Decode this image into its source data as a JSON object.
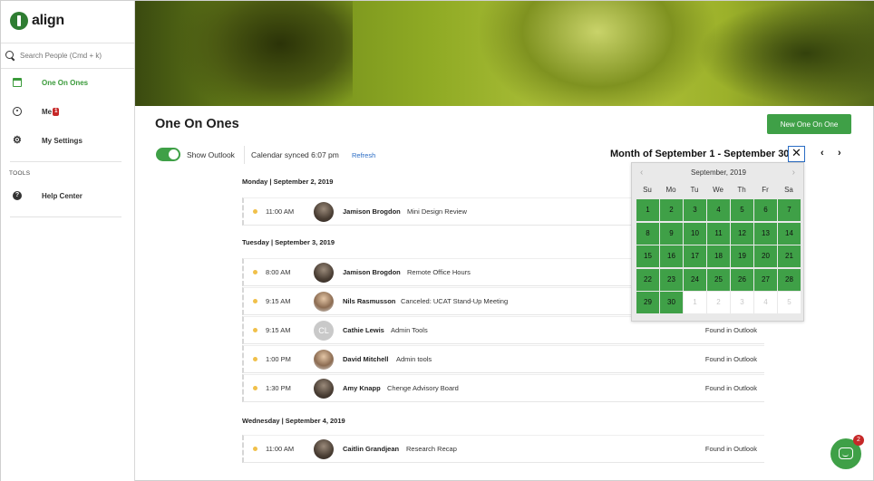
{
  "sidebar": {
    "logo_text": "align",
    "search_placeholder": "Search People (Cmd + k)",
    "items": [
      {
        "label": "One On Ones",
        "icon": "calendar-icon"
      },
      {
        "label": "Me",
        "icon": "user-icon",
        "badge": "1"
      },
      {
        "label": "My Settings",
        "icon": "gear-icon"
      }
    ],
    "tools_label": "TOOLS",
    "tools_items": [
      {
        "label": "Help Center",
        "icon": "help-icon"
      }
    ]
  },
  "main": {
    "title": "One On Ones",
    "new_button": "New One On One",
    "show_outlook_label": "Show Outlook",
    "synced_text": "Calendar synced 6:07 pm",
    "refresh_label": "Refresh",
    "month_title": "Month of September 1 - September 30",
    "close_symbol": "✕",
    "prev_symbol": "‹",
    "next_symbol": "›"
  },
  "days": [
    {
      "header": "Monday | September 2, 2019",
      "events": [
        {
          "time": "11:00 AM",
          "name": "Jamison Brogdon",
          "title": "Mini Design Review",
          "source": ""
        }
      ]
    },
    {
      "header": "Tuesday | September 3, 2019",
      "events": [
        {
          "time": "8:00 AM",
          "name": "Jamison Brogdon",
          "title": "Remote Office Hours",
          "source": ""
        },
        {
          "time": "9:15 AM",
          "name": "Nils Rasmusson",
          "title": "Canceled: UCAT Stand-Up Meeting",
          "source": ""
        },
        {
          "time": "9:15 AM",
          "name": "Cathie Lewis",
          "title": "Admin Tools",
          "source": "Found in Outlook",
          "initials": "CL"
        },
        {
          "time": "1:00 PM",
          "name": "David Mitchell",
          "title": "Admin tools",
          "source": "Found in Outlook"
        },
        {
          "time": "1:30 PM",
          "name": "Amy Knapp",
          "title": "Chenge Advisory Board",
          "source": "Found in Outlook"
        }
      ]
    },
    {
      "header": "Wednesday | September 4, 2019",
      "events": [
        {
          "time": "11:00 AM",
          "name": "Caitlin Grandjean",
          "title": "Research Recap",
          "source": "Found in Outlook"
        }
      ]
    }
  ],
  "datepicker": {
    "month_label": "September, 2019",
    "prev_symbol": "‹",
    "next_symbol": "›",
    "weekdays": [
      "Su",
      "Mo",
      "Tu",
      "We",
      "Th",
      "Fr",
      "Sa"
    ],
    "weeks": [
      [
        "1",
        "2",
        "3",
        "4",
        "5",
        "6",
        "7"
      ],
      [
        "8",
        "9",
        "10",
        "11",
        "12",
        "13",
        "14"
      ],
      [
        "15",
        "16",
        "17",
        "18",
        "19",
        "20",
        "21"
      ],
      [
        "22",
        "23",
        "24",
        "25",
        "26",
        "27",
        "28"
      ],
      [
        "29",
        "30",
        "1",
        "2",
        "3",
        "4",
        "5"
      ]
    ]
  },
  "chat": {
    "count": "2"
  },
  "colors": {
    "accent": "#3fa047",
    "link": "#2a6cc4",
    "badge": "#c62828"
  }
}
